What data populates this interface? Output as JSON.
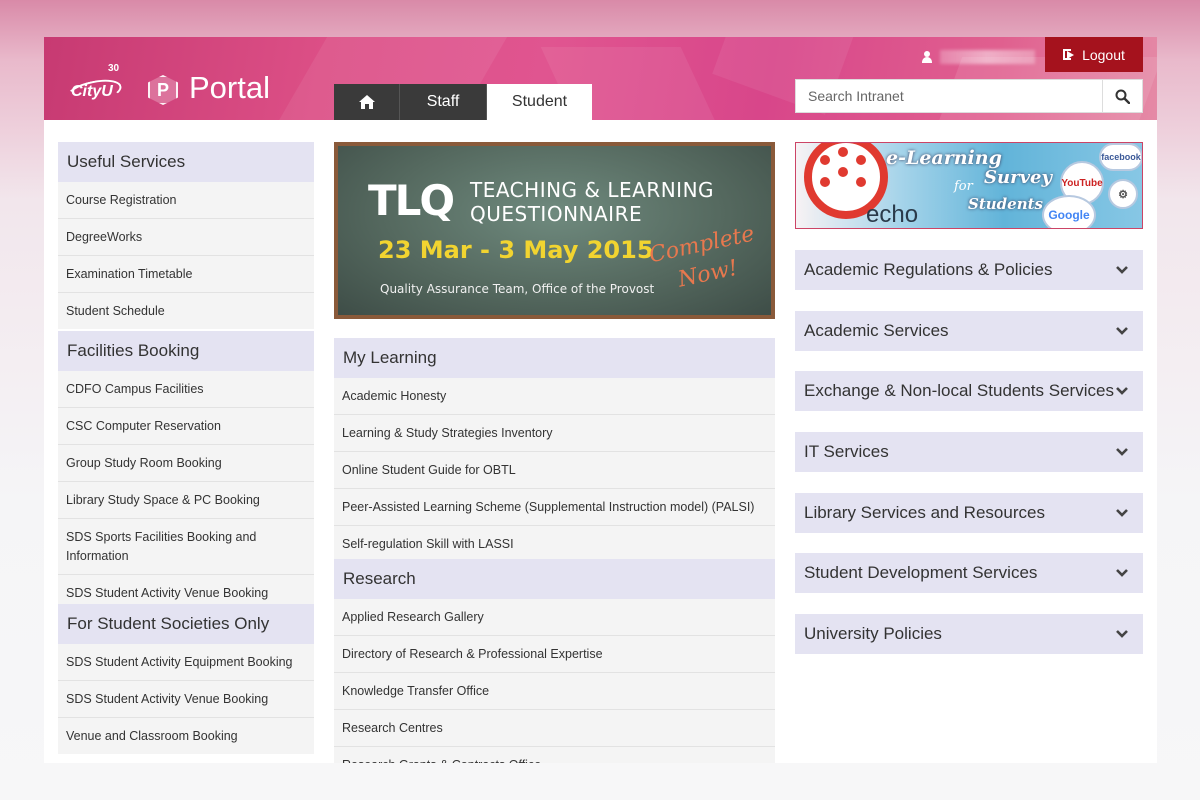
{
  "header": {
    "logo_text": "CityU",
    "logo_sup": "30",
    "portal_badge": "P",
    "portal_label": "Portal",
    "logout_label": "Logout",
    "search_placeholder": "Search Intranet",
    "tabs": [
      {
        "label": "Staff",
        "active": false
      },
      {
        "label": "Student",
        "active": true
      }
    ]
  },
  "left_panels": [
    {
      "title": "Useful Services",
      "items": [
        "Course Registration",
        "DegreeWorks",
        "Examination Timetable",
        "Student Schedule"
      ]
    },
    {
      "title": "Facilities Booking",
      "items": [
        "CDFO Campus Facilities",
        "CSC Computer Reservation",
        "Group Study Room Booking",
        "Library Study Space & PC Booking",
        "SDS Sports Facilities Booking and Information",
        "SDS Student Activity Venue Booking"
      ]
    },
    {
      "title": "For Student Societies Only",
      "items": [
        "SDS Student Activity Equipment Booking",
        "SDS Student Activity Venue Booking",
        "Venue and Classroom Booking"
      ]
    }
  ],
  "tlq_banner": {
    "logo": "TLQ",
    "title_line1": "TEACHING & LEARNING",
    "title_line2": "QUESTIONNAIRE",
    "dates": "23 Mar - 3 May 2015",
    "subtitle": "Quality Assurance Team, Office of the Provost",
    "cta": "Complete Now!"
  },
  "mid_panels": [
    {
      "title": "My Learning",
      "items": [
        "Academic Honesty",
        "Learning & Study Strategies Inventory",
        "Online Student Guide for OBTL",
        "Peer-Assisted Learning Scheme (Supplemental Instruction model) (PALSI)",
        "Self-regulation Skill with LASSI"
      ]
    },
    {
      "title": "Research",
      "items": [
        "Applied Research Gallery",
        "Directory of Research & Professional Expertise",
        "Knowledge Transfer Office",
        "Research Centres",
        "Research Grants & Contracts Office"
      ]
    }
  ],
  "elearning_banner": {
    "title": "e-Learning",
    "survey": "Survey",
    "for": "for",
    "students": "Students",
    "echo": "echo",
    "badges": [
      "facebook",
      "YouTube",
      "Google"
    ]
  },
  "accordions": [
    "Academic Regulations & Policies",
    "Academic Services",
    "Exchange & Non-local Students Services",
    "IT Services",
    "Library Services and Resources",
    "Student Development Services",
    "University Policies"
  ],
  "colors": {
    "header_pink": "#dc4f86",
    "logout_red": "#a5121d",
    "panel_header": "#e4e3f2",
    "panel_item_bg": "#f4f4f4"
  }
}
